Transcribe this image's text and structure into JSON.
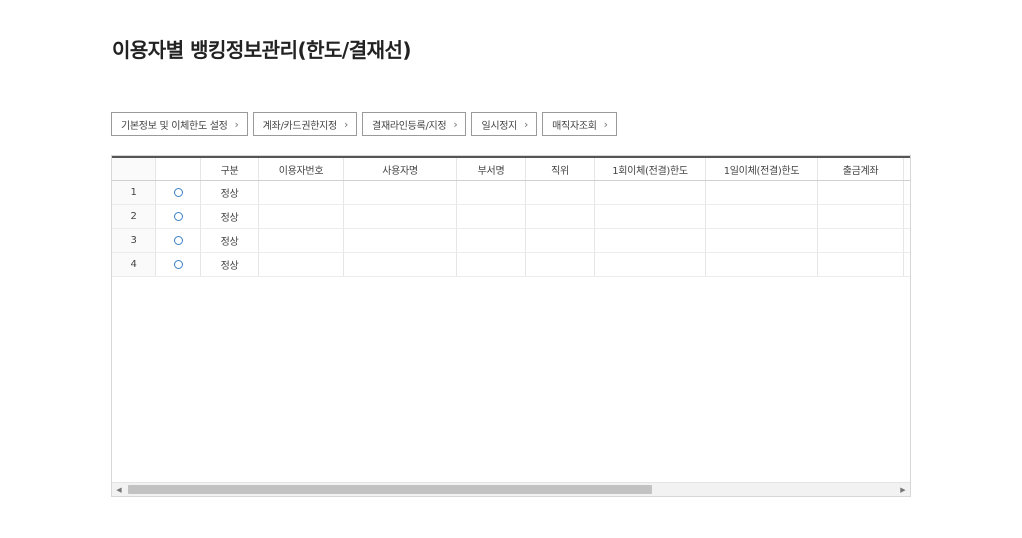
{
  "page": {
    "title": "이용자별 뱅킹정보관리(한도/결재선)"
  },
  "tabs": [
    {
      "label": "기본정보 및 이체한도 설정"
    },
    {
      "label": "계좌/카드권한지정"
    },
    {
      "label": "결재라인등록/지정"
    },
    {
      "label": "일시정지"
    },
    {
      "label": "매직자조회"
    }
  ],
  "icons": {
    "tab_chevron": "chevron-right-icon",
    "radio": "radio-icon",
    "scroll_left": "scroll-left-icon",
    "scroll_right": "scroll-right-icon"
  },
  "colors": {
    "radio_border": "#3b7fc6",
    "header_top_border": "#555555"
  },
  "grid": {
    "columns": [
      "",
      "",
      "구분",
      "이용자번호",
      "사용자명",
      "부서명",
      "직위",
      "1회이체(전결)한도",
      "1일이체(전결)한도",
      "출금계좌",
      "결"
    ],
    "rows": [
      {
        "no": "1",
        "type": "정상"
      },
      {
        "no": "2",
        "type": "정상"
      },
      {
        "no": "3",
        "type": "정상"
      },
      {
        "no": "4",
        "type": "정상"
      }
    ]
  },
  "scrollbar": {
    "left_arrow": "◀",
    "right_arrow": "▶"
  }
}
